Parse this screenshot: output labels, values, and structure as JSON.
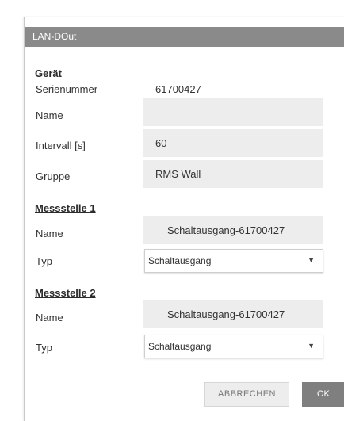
{
  "dialog": {
    "title": "LAN-DOut",
    "device_section": {
      "heading": "Gerät",
      "serial_label": "Serienummer",
      "serial_value": "61700427",
      "name_label": "Name",
      "name_value": "",
      "interval_label": "Intervall [s]",
      "interval_value": "60",
      "group_label": "Gruppe",
      "group_value": "RMS Wall"
    },
    "measuring_point_1": {
      "heading": "Messstelle 1",
      "name_label": "Name",
      "name_value": "Schaltausgang-61700427",
      "type_label": "Typ",
      "type_value": "Schaltausgang"
    },
    "measuring_point_2": {
      "heading": "Messstelle 2",
      "name_label": "Name",
      "name_value": "Schaltausgang-61700427",
      "type_label": "Typ",
      "type_value": "Schaltausgang"
    },
    "buttons": {
      "cancel_label": "ABBRECHEN",
      "ok_label": "OK"
    }
  },
  "icons": {
    "select_caret": "chevron-down-icon"
  },
  "colors": {
    "titlebar": "#8a8a8a",
    "field_background": "#ededed",
    "ok_button": "#7f7f7f"
  }
}
